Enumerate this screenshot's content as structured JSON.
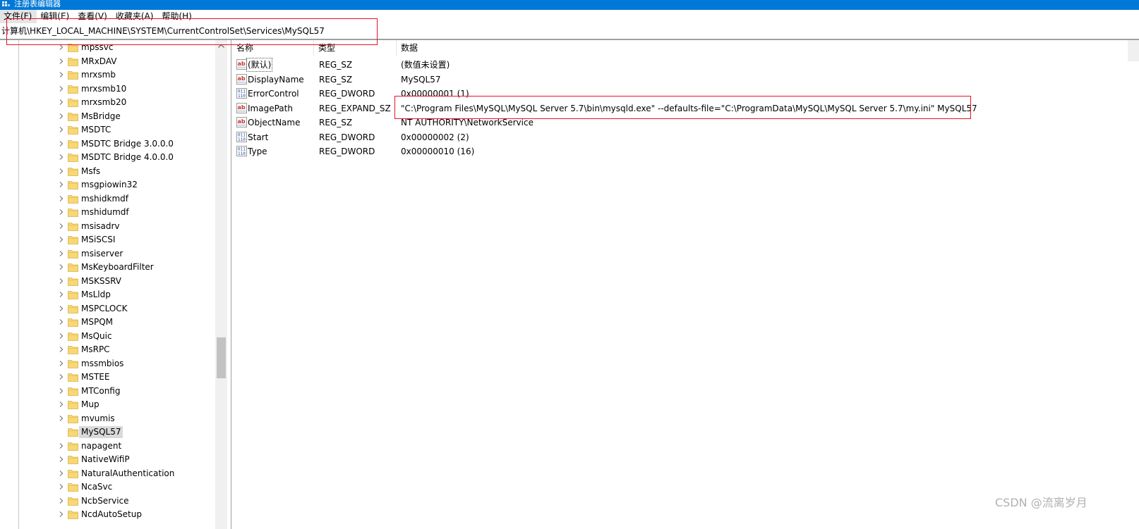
{
  "window": {
    "title": "注册表编辑器"
  },
  "menu": [
    {
      "label": "文件(F)"
    },
    {
      "label": "编辑(E)"
    },
    {
      "label": "查看(V)"
    },
    {
      "label": "收藏夹(A)"
    },
    {
      "label": "帮助(H)"
    }
  ],
  "address": {
    "path": "计算机\\HKEY_LOCAL_MACHINE\\SYSTEM\\CurrentControlSet\\Services\\MySQL57"
  },
  "tree": {
    "selected": "MySQL57",
    "items": [
      {
        "label": "mpssvc",
        "has_children": true
      },
      {
        "label": "MRxDAV",
        "has_children": true
      },
      {
        "label": "mrxsmb",
        "has_children": true
      },
      {
        "label": "mrxsmb10",
        "has_children": true
      },
      {
        "label": "mrxsmb20",
        "has_children": true
      },
      {
        "label": "MsBridge",
        "has_children": true
      },
      {
        "label": "MSDTC",
        "has_children": true
      },
      {
        "label": "MSDTC Bridge 3.0.0.0",
        "has_children": true
      },
      {
        "label": "MSDTC Bridge 4.0.0.0",
        "has_children": true
      },
      {
        "label": "Msfs",
        "has_children": true
      },
      {
        "label": "msgpiowin32",
        "has_children": true
      },
      {
        "label": "mshidkmdf",
        "has_children": true
      },
      {
        "label": "mshidumdf",
        "has_children": true
      },
      {
        "label": "msisadrv",
        "has_children": true
      },
      {
        "label": "MSiSCSI",
        "has_children": true
      },
      {
        "label": "msiserver",
        "has_children": true
      },
      {
        "label": "MsKeyboardFilter",
        "has_children": true
      },
      {
        "label": "MSKSSRV",
        "has_children": true
      },
      {
        "label": "MsLldp",
        "has_children": true
      },
      {
        "label": "MSPCLOCK",
        "has_children": true
      },
      {
        "label": "MSPQM",
        "has_children": true
      },
      {
        "label": "MsQuic",
        "has_children": true
      },
      {
        "label": "MsRPC",
        "has_children": true
      },
      {
        "label": "mssmbios",
        "has_children": true
      },
      {
        "label": "MSTEE",
        "has_children": true
      },
      {
        "label": "MTConfig",
        "has_children": true
      },
      {
        "label": "Mup",
        "has_children": true
      },
      {
        "label": "mvumis",
        "has_children": true
      },
      {
        "label": "MySQL57",
        "has_children": false
      },
      {
        "label": "napagent",
        "has_children": true
      },
      {
        "label": "NativeWifiP",
        "has_children": true
      },
      {
        "label": "NaturalAuthentication",
        "has_children": true
      },
      {
        "label": "NcaSvc",
        "has_children": true
      },
      {
        "label": "NcbService",
        "has_children": true
      },
      {
        "label": "NcdAutoSetup",
        "has_children": true
      }
    ]
  },
  "columns": {
    "name": "名称",
    "type": "类型",
    "data": "数据"
  },
  "values": [
    {
      "icon": "string-value-icon",
      "name": "(默认)",
      "type": "REG_SZ",
      "data": "(数值未设置)"
    },
    {
      "icon": "string-value-icon",
      "name": "DisplayName",
      "type": "REG_SZ",
      "data": "MySQL57"
    },
    {
      "icon": "binary-value-icon",
      "name": "ErrorControl",
      "type": "REG_DWORD",
      "data": "0x00000001 (1)"
    },
    {
      "icon": "string-value-icon",
      "name": "ImagePath",
      "type": "REG_EXPAND_SZ",
      "data": "\"C:\\Program Files\\MySQL\\MySQL Server 5.7\\bin\\mysqld.exe\" --defaults-file=\"C:\\ProgramData\\MySQL\\MySQL Server 5.7\\my.ini\" MySQL57"
    },
    {
      "icon": "string-value-icon",
      "name": "ObjectName",
      "type": "REG_SZ",
      "data": "NT AUTHORITY\\NetworkService"
    },
    {
      "icon": "binary-value-icon",
      "name": "Start",
      "type": "REG_DWORD",
      "data": "0x00000002 (2)"
    },
    {
      "icon": "binary-value-icon",
      "name": "Type",
      "type": "REG_DWORD",
      "data": "0x00000010 (16)"
    }
  ],
  "watermark": {
    "text": "CSDN @流离岁月"
  },
  "colors": {
    "titlebar": "#0078d7",
    "highlight_box": "#e81123",
    "folder": "#f8d775"
  }
}
